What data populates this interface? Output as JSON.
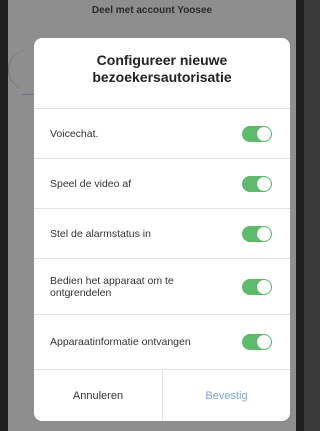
{
  "background": {
    "title": "Deel met account Yoosee"
  },
  "dialog": {
    "title": "Configureer nieuwe bezoekersautorisatie",
    "permissions": [
      {
        "label": "Voicechat.",
        "enabled": true
      },
      {
        "label": "Speel de video af",
        "enabled": true
      },
      {
        "label": "Stel de alarmstatus in",
        "enabled": true
      },
      {
        "label": "Bedien het apparaat om te ontgrendelen",
        "enabled": true
      },
      {
        "label": "Apparaatinformatie ontvangen",
        "enabled": true
      }
    ],
    "cancel_label": "Annuleren",
    "confirm_label": "Bevestig"
  },
  "colors": {
    "toggle_on": "#5dbb6b",
    "confirm_text": "#7aa6d8",
    "overlay": "#8e8e8e"
  }
}
